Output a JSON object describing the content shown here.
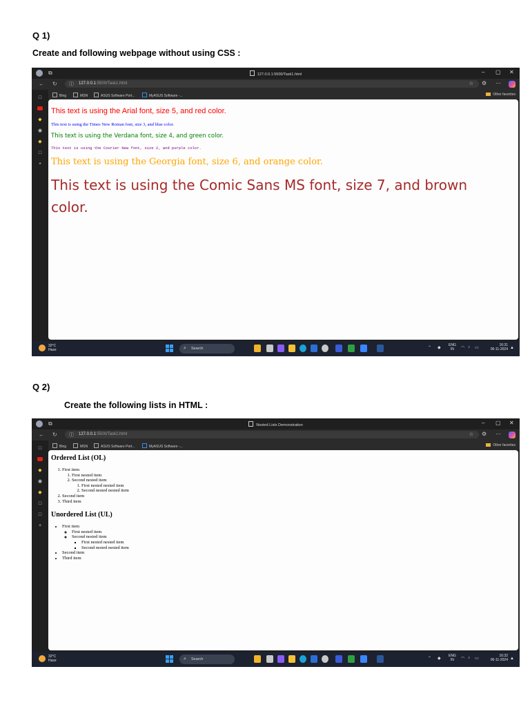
{
  "q1": {
    "label": "Q 1)",
    "prompt": "Create and following webpage without using CSS :",
    "browser": {
      "tab_title": "127.0.0.1:5500/Task1.html",
      "url_host": "127.0.0.1",
      "url_path": ":5500/Task1.html",
      "favorites": [
        "Bing",
        "MSN",
        "ASUS Software Port...",
        "MyASUS Software -..."
      ],
      "other_favorites": "Other favorites"
    },
    "lines": [
      "This text is using the Arial font, size 5, and red color.",
      "This text is using the Times New Roman font, size 3, and blue color.",
      "This text is using the Verdana font, size 4, and green color.",
      "This text is using the Courier New font, size 2, and purple color.",
      "This text is using the Georgia font, size 6, and orange color.",
      "This text is using the Comic Sans MS font, size 7, and brown color."
    ],
    "line_colors": [
      "#ff0000",
      "#0000ff",
      "#008000",
      "#800080",
      "#ffa500",
      "#a52a2a"
    ],
    "taskbar": {
      "temp": "32°C",
      "weather": "Haze",
      "search": "Search",
      "lang1": "ENG",
      "lang2": "IN",
      "time": "16:31",
      "date": "06-11-2024"
    }
  },
  "q2": {
    "label": "Q 2)",
    "prompt": "Create the following lists in HTML :",
    "browser": {
      "tab_title": "Nested Lists Demonstration",
      "url_host": "127.0.0.1",
      "url_path": ":5500/Task2.html",
      "favorites": [
        "Bing",
        "MSN",
        "ASUS Software Port...",
        "MyASUS Software -..."
      ],
      "other_favorites": "Other favorites"
    },
    "ordered": {
      "heading": "Ordered List (OL)",
      "items": [
        "First item",
        "First nested item",
        "Second nested item",
        "First nested nested item",
        "Second nested nested item",
        "Second item",
        "Third item"
      ]
    },
    "unordered": {
      "heading": "Unordered List (UL)",
      "items": [
        "First item",
        "First nested item",
        "Second nested item",
        "First nested nested item",
        "Second nested nested item",
        "Second item",
        "Third item"
      ]
    },
    "taskbar": {
      "temp": "32°C",
      "weather": "Haze",
      "search": "Search",
      "lang1": "ENG",
      "lang2": "IN",
      "time": "16:32",
      "date": "06-11-2024"
    }
  },
  "icons": [
    "avatar-icon",
    "tabs-icon",
    "document-icon",
    "minimize-icon",
    "maximize-icon",
    "close-icon",
    "back-icon",
    "refresh-icon",
    "info-icon",
    "star-icon",
    "settings-icon",
    "more-icon",
    "copilot-icon",
    "folder-icon",
    "windows-start-icon",
    "search-icon",
    "weather-icon",
    "wifi-icon",
    "speaker-icon",
    "battery-icon",
    "bell-icon"
  ]
}
